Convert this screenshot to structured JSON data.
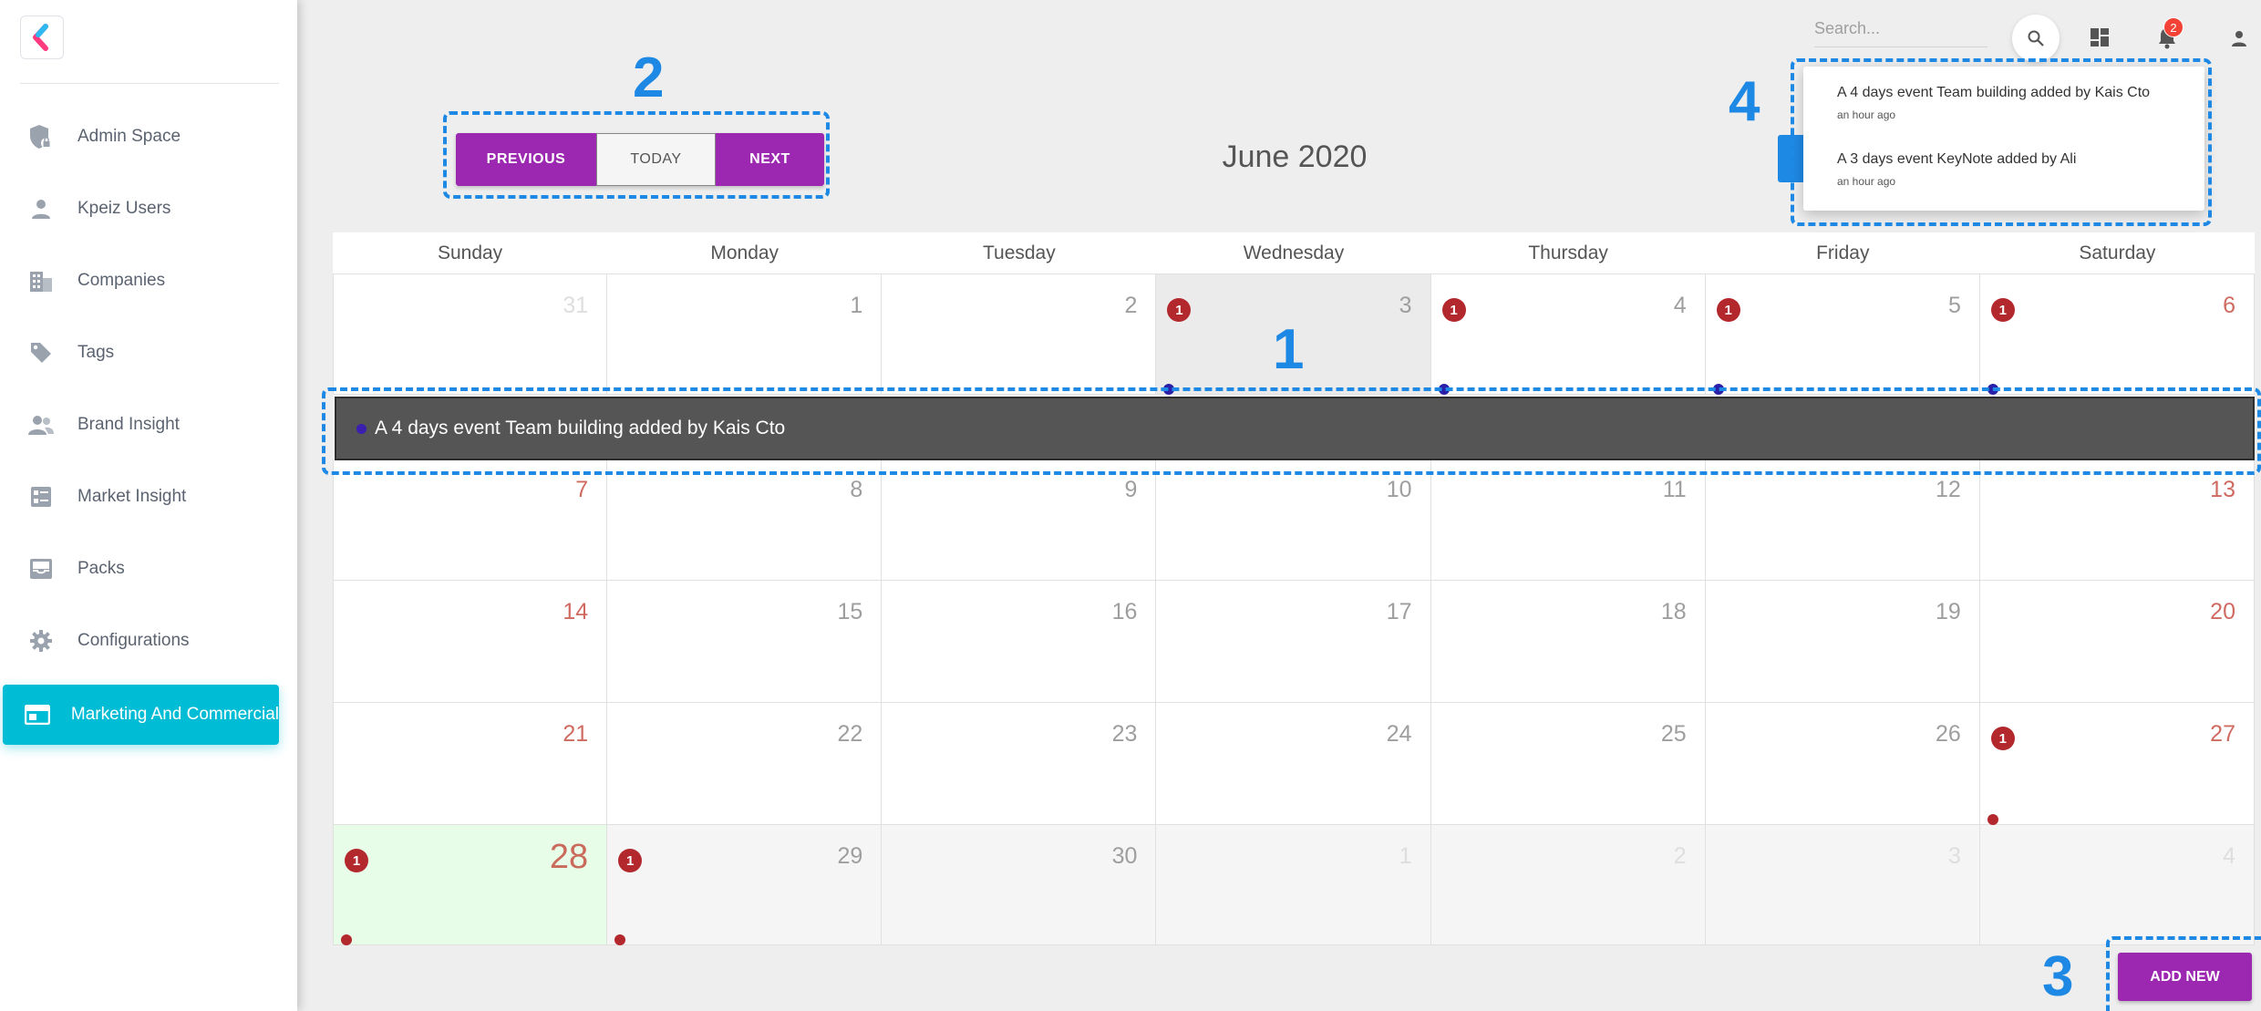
{
  "sidebar": {
    "items": [
      {
        "label": "Admin Space"
      },
      {
        "label": "Kpeiz Users"
      },
      {
        "label": "Companies"
      },
      {
        "label": "Tags"
      },
      {
        "label": "Brand Insight"
      },
      {
        "label": "Market Insight"
      },
      {
        "label": "Packs"
      },
      {
        "label": "Configurations"
      },
      {
        "label": "Marketing And Commercial",
        "active": true
      }
    ]
  },
  "topbar": {
    "search_placeholder": "Search...",
    "notification_count": "2"
  },
  "toolbar": {
    "previous_label": "PREVIOUS",
    "today_label": "TODAY",
    "next_label": "NEXT",
    "month_title": "June 2020"
  },
  "calendar": {
    "weekdays": [
      "Sunday",
      "Monday",
      "Tuesday",
      "Wednesday",
      "Thursday",
      "Friday",
      "Saturday"
    ],
    "weeks": [
      [
        {
          "day": "31",
          "outside": true
        },
        {
          "day": "1"
        },
        {
          "day": "2"
        },
        {
          "day": "3",
          "badge": "1",
          "dot": "#2a1fa8",
          "selected": true
        },
        {
          "day": "4",
          "badge": "1",
          "dot": "#2a1fa8"
        },
        {
          "day": "5",
          "badge": "1",
          "dot": "#2a1fa8"
        },
        {
          "day": "6",
          "badge": "1",
          "dot": "#2a1fa8"
        }
      ],
      [
        {
          "day": "7"
        },
        {
          "day": "8"
        },
        {
          "day": "9"
        },
        {
          "day": "10"
        },
        {
          "day": "11"
        },
        {
          "day": "12"
        },
        {
          "day": "13"
        }
      ],
      [
        {
          "day": "14"
        },
        {
          "day": "15"
        },
        {
          "day": "16"
        },
        {
          "day": "17"
        },
        {
          "day": "18"
        },
        {
          "day": "19"
        },
        {
          "day": "20"
        }
      ],
      [
        {
          "day": "21"
        },
        {
          "day": "22"
        },
        {
          "day": "23"
        },
        {
          "day": "24"
        },
        {
          "day": "25"
        },
        {
          "day": "26"
        },
        {
          "day": "27",
          "badge": "1",
          "dot": "#b3282d"
        }
      ],
      [
        {
          "day": "28",
          "badge": "1",
          "dot": "#b3282d",
          "today": true
        },
        {
          "day": "29",
          "badge": "1",
          "dot": "#b3282d"
        },
        {
          "day": "30"
        },
        {
          "day": "1",
          "outside": true
        },
        {
          "day": "2",
          "outside": true
        },
        {
          "day": "3",
          "outside": true
        },
        {
          "day": "4",
          "outside": true
        }
      ]
    ],
    "event_bar_text": "A 4 days event Team building added by Kais Cto"
  },
  "notifications": [
    {
      "title": "A 4 days event Team building added by Kais Cto",
      "time": "an hour ago"
    },
    {
      "title": "A 3 days event KeyNote added by Ali",
      "time": "an hour ago"
    }
  ],
  "actions": {
    "add_new_label": "ADD NEW"
  },
  "annotations": {
    "one": "1",
    "two": "2",
    "three": "3",
    "four": "4"
  },
  "colors": {
    "accent_purple": "#9c27b0",
    "sidebar_active": "#00bcd4",
    "badge_red": "#b3282d",
    "annotation_blue": "#1e88e5",
    "today_bg": "#e8fde8"
  }
}
